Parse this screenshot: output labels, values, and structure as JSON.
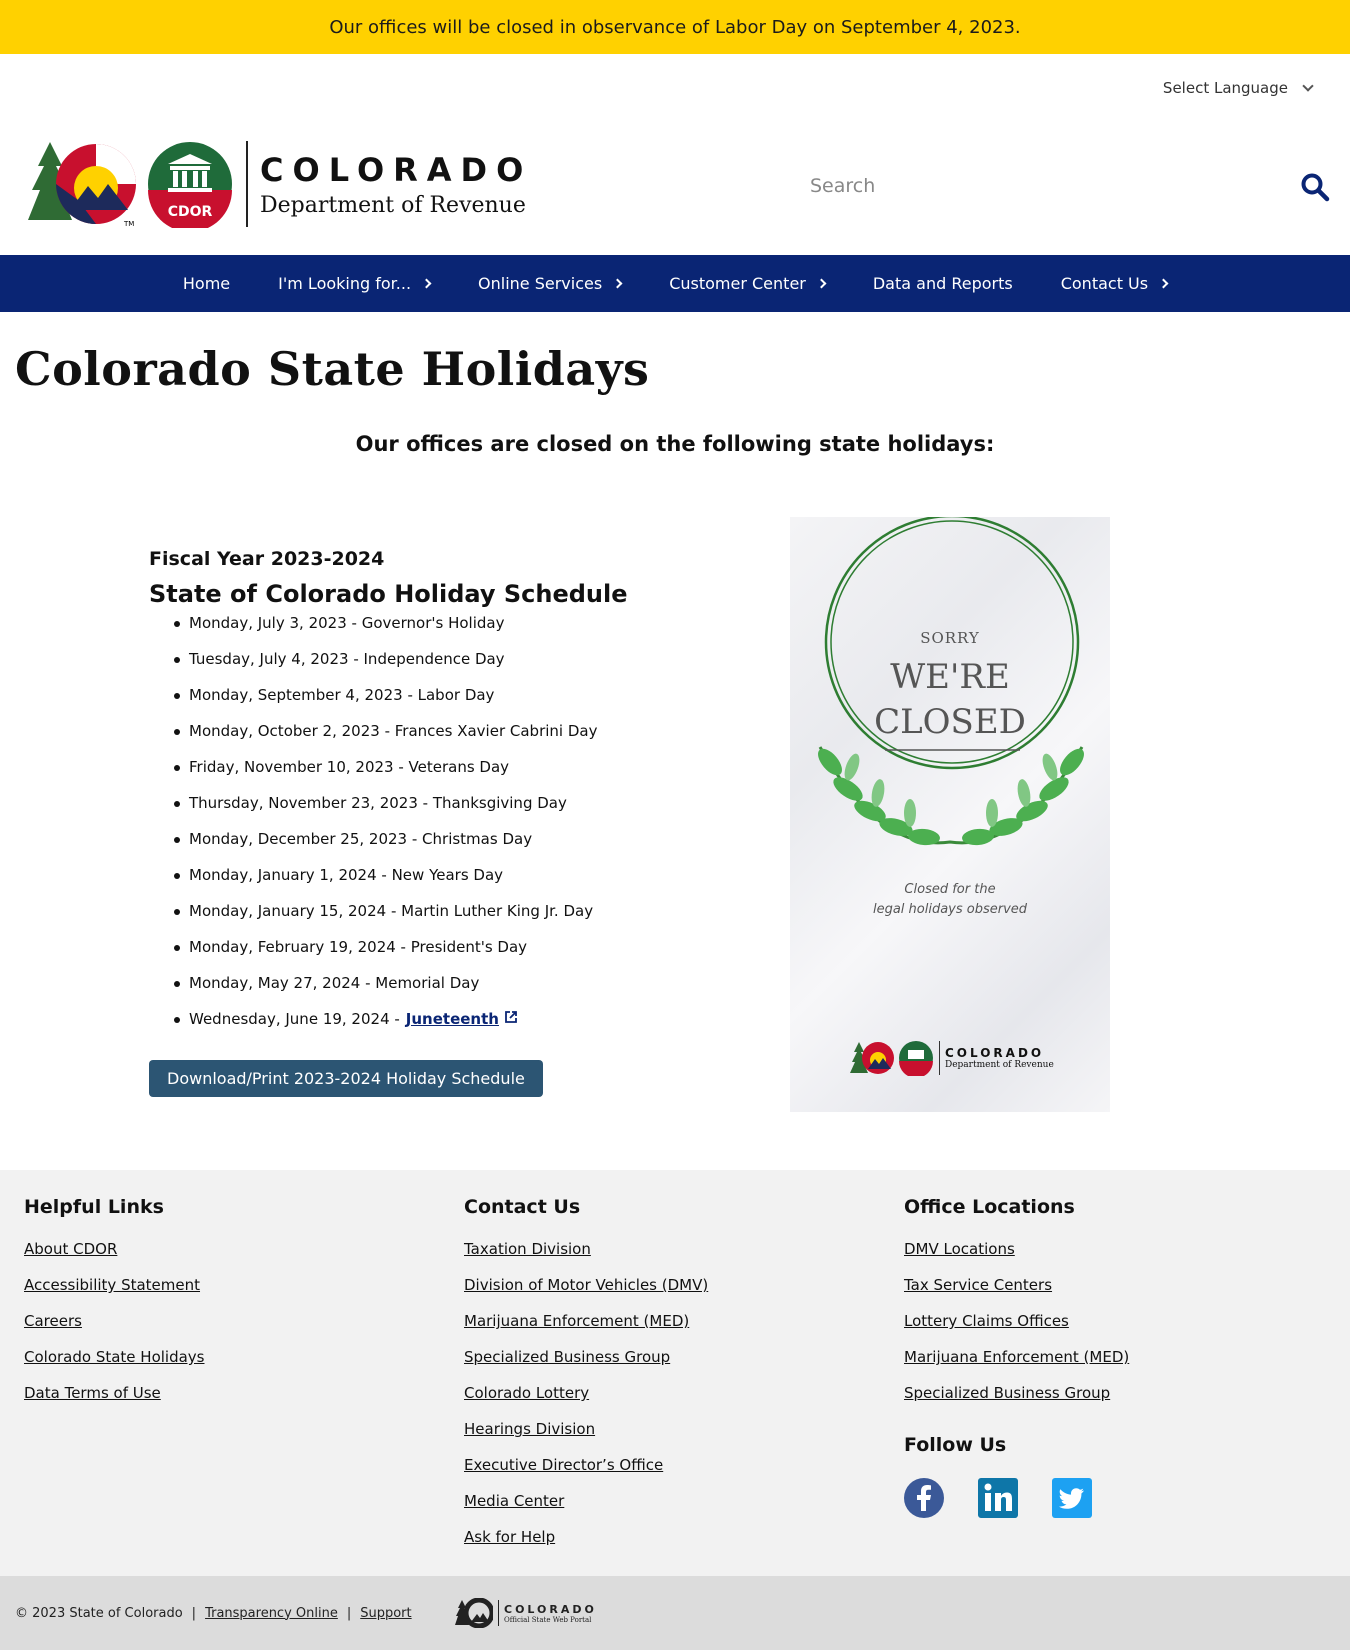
{
  "alert": {
    "text": "Our offices will be closed in observance of Labor Day on September 4, 2023."
  },
  "language": {
    "label": "Select Language"
  },
  "logo": {
    "name": "COLORADO",
    "dept": "Department of Revenue",
    "seal_text": "CDOR",
    "tm": "TM"
  },
  "search": {
    "placeholder": "Search"
  },
  "nav": {
    "items": [
      {
        "label": "Home"
      },
      {
        "label": "I'm Looking for..."
      },
      {
        "label": "Online Services"
      },
      {
        "label": "Customer Center"
      },
      {
        "label": "Data and Reports"
      },
      {
        "label": "Contact Us"
      }
    ]
  },
  "page": {
    "title": "Colorado State Holidays",
    "subtitle": "Our offices are closed on the following state holidays:"
  },
  "schedule": {
    "fiscal_year": "Fiscal Year 2023-2024",
    "title": "State of Colorado Holiday Schedule",
    "holidays": [
      "Monday, July 3, 2023 - Governor's Holiday",
      "Tuesday, July 4, 2023 - Independence Day",
      "Monday, September 4, 2023 - Labor Day",
      "Monday, October 2, 2023 - Frances Xavier Cabrini Day",
      "Friday, November 10, 2023 - Veterans Day",
      "Thursday, November 23, 2023 - Thanksgiving Day",
      "Monday, December 25, 2023 - Christmas Day",
      "Monday, January 1, 2024 - New Years Day",
      "Monday, January 15, 2024 - Martin Luther King Jr. Day",
      "Monday, February 19, 2024 - President's Day",
      "Monday, May 27, 2024 - Memorial Day"
    ],
    "last_prefix": "Wednesday, June 19, 2024 -",
    "last_link": "Juneteenth",
    "download_label": "Download/Print 2023-2024 Holiday Schedule"
  },
  "closed_image": {
    "sorry": "SORRY",
    "were": "WE'RE",
    "closed": "CLOSED",
    "sub1": "Closed for the",
    "sub2": "legal holidays observed",
    "logo_name": "COLORADO",
    "logo_dept": "Department of Revenue"
  },
  "footer": {
    "helpful": {
      "title": "Helpful Links",
      "links": [
        "About CDOR",
        "Accessibility Statement",
        "Careers",
        "Colorado State Holidays",
        "Data Terms of Use"
      ]
    },
    "contact": {
      "title": "Contact Us",
      "links": [
        "Taxation Division",
        "Division of Motor Vehicles (DMV)",
        "Marijuana Enforcement (MED)",
        "Specialized Business Group",
        "Colorado Lottery",
        "Hearings Division",
        "Executive Director’s Office",
        "Media Center",
        "Ask for Help"
      ]
    },
    "offices": {
      "title": "Office Locations",
      "links": [
        "DMV Locations",
        "Tax Service Centers",
        "Lottery Claims Offices",
        "Marijuana Enforcement (MED)",
        "Specialized Business Group"
      ]
    },
    "follow": {
      "title": "Follow Us",
      "icons": [
        "facebook-icon",
        "linkedin-icon",
        "twitter-icon"
      ]
    }
  },
  "bottom": {
    "copyright": "© 2023 State of Colorado",
    "sep": "|",
    "transparency": "Transparency Online",
    "support": "Support",
    "portal_name": "COLORADO",
    "portal_sub": "Official State Web Portal"
  },
  "colors": {
    "alert": "#ffd100",
    "nav": "#0a2574",
    "button": "#2c5573",
    "footer": "#f2f2f2",
    "bottom": "#dcdcdc"
  }
}
